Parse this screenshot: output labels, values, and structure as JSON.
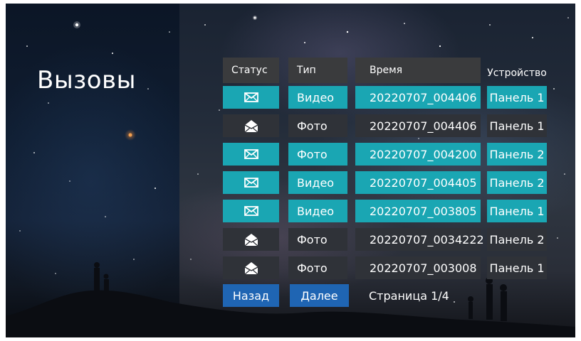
{
  "page": {
    "title": "Вызовы"
  },
  "table": {
    "headers": {
      "status": "Статус",
      "type": "Тип",
      "time": "Время",
      "device": "Устройство"
    },
    "rows": [
      {
        "status_icon": "envelope-closed-icon",
        "type": "Видео",
        "time": "20220707_004406",
        "device": "Панель 1",
        "unread": true
      },
      {
        "status_icon": "envelope-open-icon",
        "type": "Фото",
        "time": "20220707_004406",
        "device": "Панель 1",
        "unread": false
      },
      {
        "status_icon": "envelope-closed-icon",
        "type": "Фото",
        "time": "20220707_004200",
        "device": "Панель 2",
        "unread": true
      },
      {
        "status_icon": "envelope-closed-icon",
        "type": "Видео",
        "time": "20220707_004405",
        "device": "Панель 2",
        "unread": true
      },
      {
        "status_icon": "envelope-closed-icon",
        "type": "Видео",
        "time": "20220707_003805",
        "device": "Панель 1",
        "unread": true
      },
      {
        "status_icon": "envelope-open-icon",
        "type": "Фото",
        "time": "20220707_0034222",
        "device": "Панель 2",
        "unread": false
      },
      {
        "status_icon": "envelope-open-icon",
        "type": "Фото",
        "time": "20220707_003008",
        "device": "Панель 1",
        "unread": false
      }
    ]
  },
  "nav": {
    "back_label": "Назад",
    "next_label": "Далее",
    "page_indicator": "Страница 1/4"
  },
  "colors": {
    "unread_row": "#1aa6b3",
    "read_row": "#2f3238",
    "header_bg": "#3a3b3d",
    "nav_button": "#1f65b3"
  }
}
